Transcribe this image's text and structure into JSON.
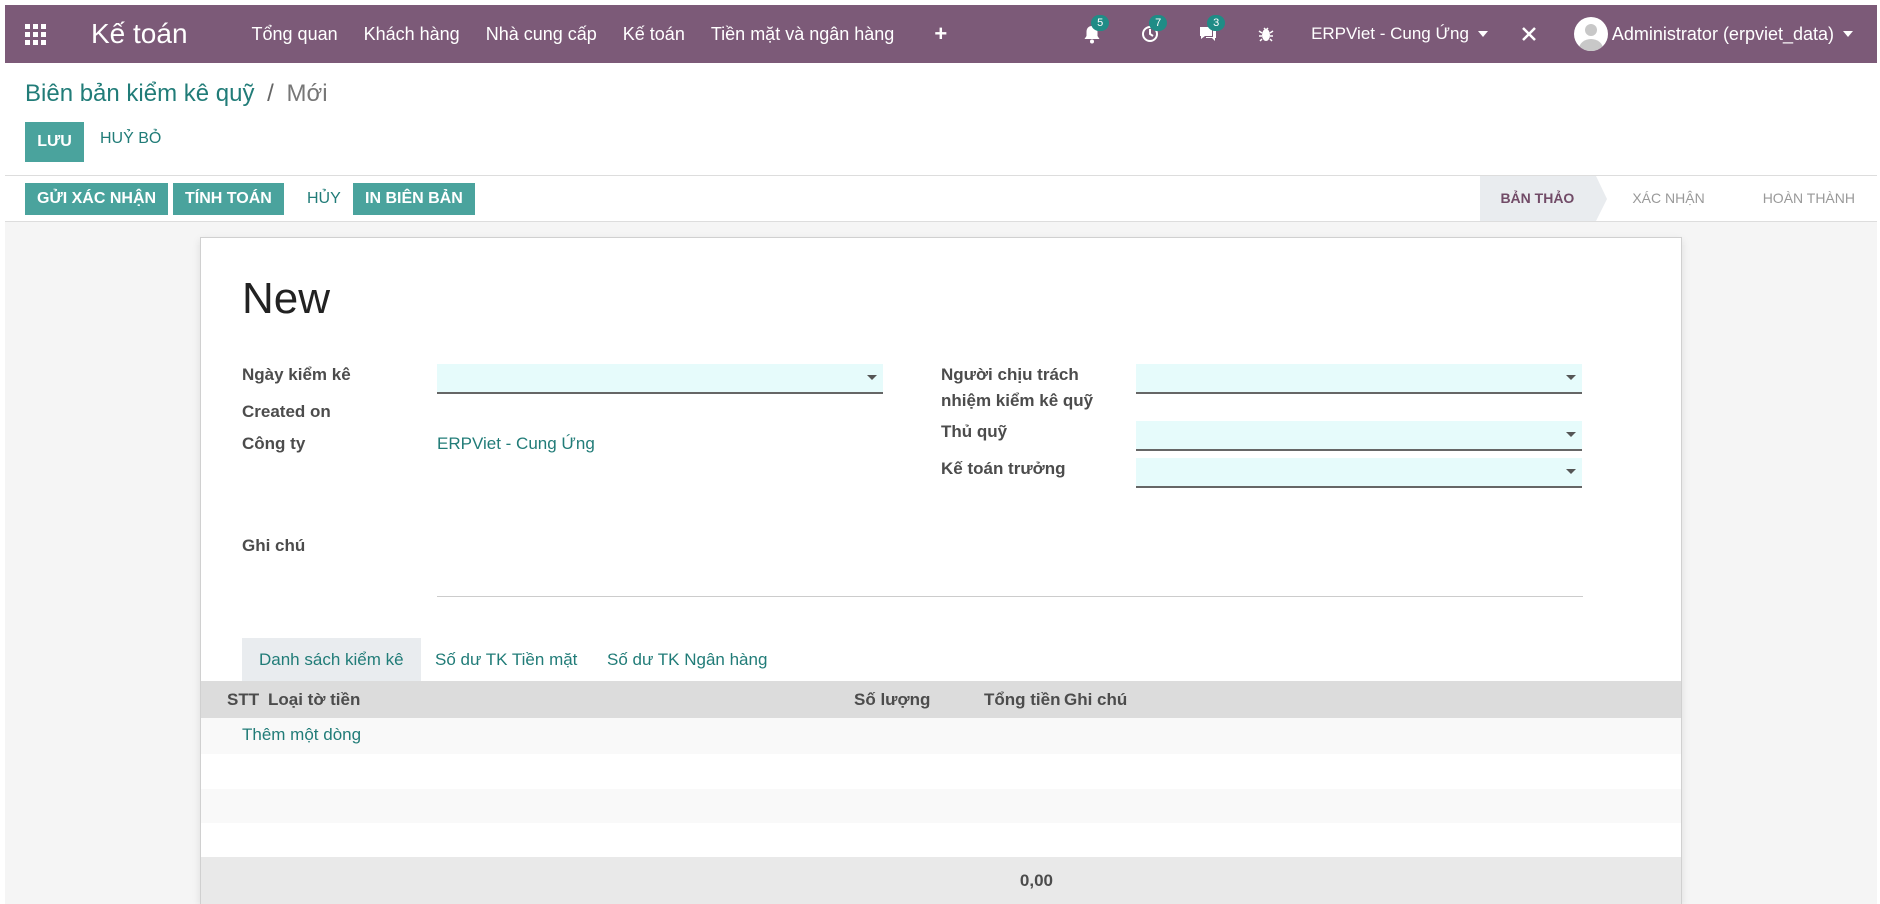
{
  "navbar": {
    "brand": "Kế toán",
    "menu": [
      "Tổng quan",
      "Khách hàng",
      "Nhà cung cấp",
      "Kế toán",
      "Tiền mặt và ngân hàng"
    ],
    "plus": "+",
    "notifications_count": "5",
    "activities_count": "7",
    "messages_count": "3",
    "company": "ERPViet - Cung Ứng",
    "user": "Administrator (erpviet_data)"
  },
  "breadcrumb": {
    "parent": "Biên bản kiểm kê quỹ",
    "separator": "/",
    "current": "Mới"
  },
  "actions": {
    "save": "Lưu",
    "discard": "Huỷ bỏ"
  },
  "statusbar": {
    "buttons": [
      "Gửi xác nhận",
      "Tính toán",
      "Hủy",
      "In biên bản"
    ],
    "stages": [
      "Bản thảo",
      "Xác nhận",
      "Hoàn thành"
    ],
    "active_stage": "Bản thảo"
  },
  "form": {
    "title": "New",
    "labels": {
      "date": "Ngày kiểm kê",
      "created_on": "Created on",
      "company": "Công ty",
      "responsible_line1": "Người chịu trách",
      "responsible_line2": "nhiệm kiểm kê quỹ",
      "cashier": "Thủ quỹ",
      "chief_accountant": "Kế toán trưởng",
      "note": "Ghi chú"
    },
    "values": {
      "company": "ERPViet - Cung Ứng"
    }
  },
  "notebook": {
    "tabs": [
      "Danh sách kiểm kê",
      "Số dư TK Tiền mặt",
      "Số dư TK Ngân hàng"
    ],
    "active_tab": "Danh sách kiểm kê",
    "columns": [
      "STT",
      "Loại tờ tiền",
      "Số lượng",
      "Tổng tiền",
      "Ghi chú"
    ],
    "add_line": "Thêm một dòng",
    "total": "0,00"
  },
  "colors": {
    "navbar": "#7c5a78",
    "primary": "#4aa39d",
    "link": "#217c78",
    "input_bg": "#e6fbfb"
  }
}
